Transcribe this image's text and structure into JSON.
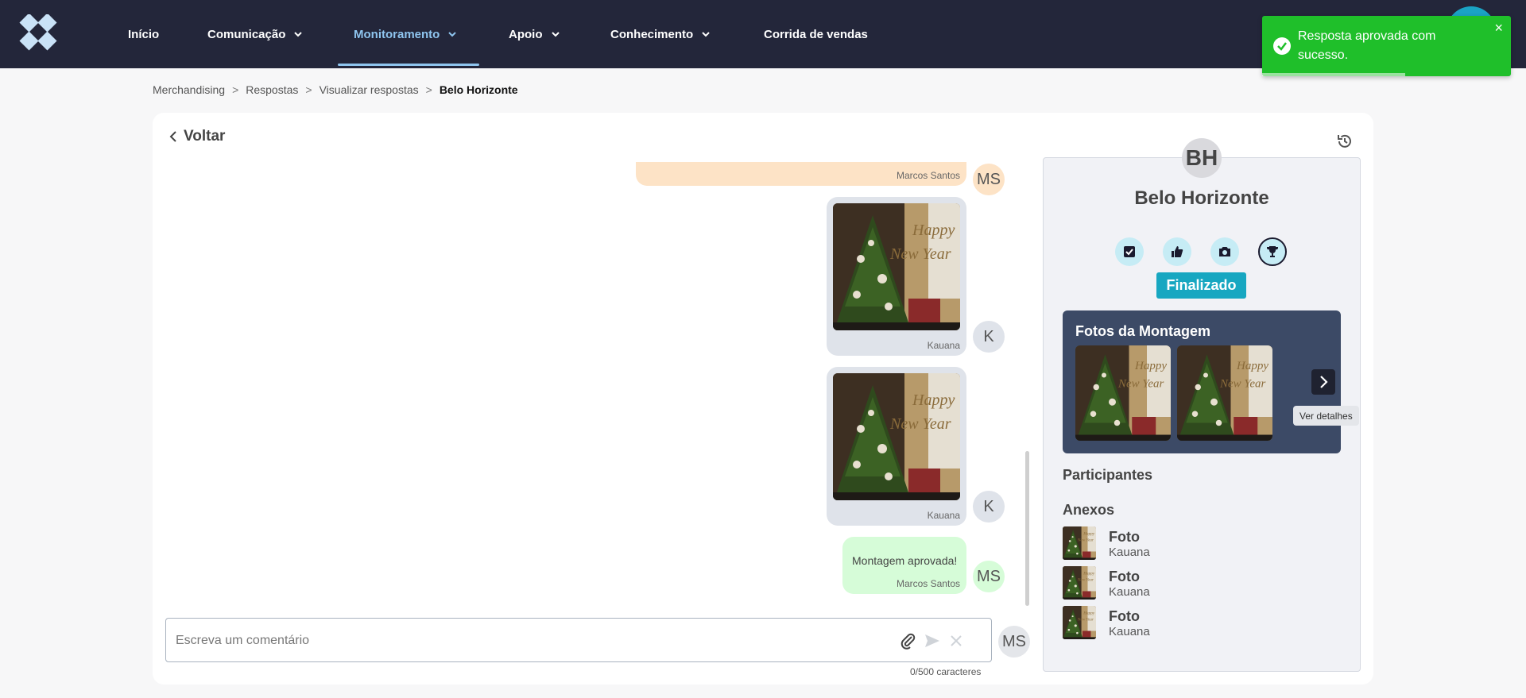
{
  "nav": {
    "items": [
      {
        "label": "Início",
        "has_dropdown": false
      },
      {
        "label": "Comunicação",
        "has_dropdown": true
      },
      {
        "label": "Monitoramento",
        "has_dropdown": true,
        "active": true
      },
      {
        "label": "Apoio",
        "has_dropdown": true
      },
      {
        "label": "Conhecimento",
        "has_dropdown": true
      },
      {
        "label": "Corrida de vendas",
        "has_dropdown": false
      }
    ]
  },
  "toast": {
    "message": "Resposta aprovada com sucesso.",
    "close": "×"
  },
  "breadcrumb": {
    "items": [
      "Merchandising",
      "Respostas",
      "Visualizar respostas"
    ],
    "current": "Belo Horizonte",
    "separator": ">"
  },
  "back_label": "Voltar",
  "chat": {
    "messages": [
      {
        "type": "text",
        "text": "",
        "author": "Marcos Santos",
        "avatar": "MS",
        "color": "#fde3c6"
      },
      {
        "type": "photo",
        "author": "Kauana",
        "avatar": "K"
      },
      {
        "type": "photo",
        "author": "Kauana",
        "avatar": "K"
      },
      {
        "type": "text",
        "text": "Montagem aprovada!",
        "author": "Marcos Santos",
        "avatar": "MS",
        "color": "#d6fcd8"
      }
    ]
  },
  "composer": {
    "placeholder": "Escreva um comentário",
    "char_count": "0/500 caracteres",
    "avatar": "MS"
  },
  "panel": {
    "initials": "BH",
    "title": "Belo Horizonte",
    "status": "Finalizado",
    "status_icons": [
      "checkbox-icon",
      "thumbs-up-icon",
      "camera-icon",
      "trophy-icon"
    ],
    "gallery_title": "Fotos da Montagem",
    "gallery_tooltip": "Ver detalhes",
    "participants_title": "Participantes",
    "attachments_title": "Anexos",
    "attachments": [
      {
        "name": "Foto",
        "author": "Kauana"
      },
      {
        "name": "Foto",
        "author": "Kauana"
      },
      {
        "name": "Foto",
        "author": "Kauana"
      }
    ]
  },
  "colors": {
    "topbar": "#23263a",
    "active_nav": "#8fc5ef",
    "toast": "#1fbf2a",
    "status": "#17a7c1",
    "gallery": "#3c4a66"
  }
}
